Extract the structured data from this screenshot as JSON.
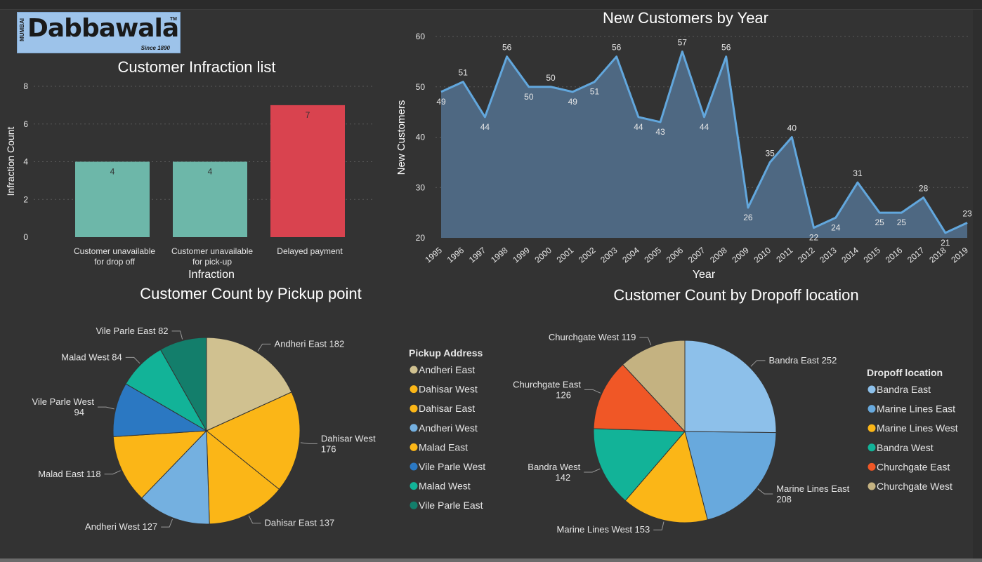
{
  "logo": {
    "word": "Dabbawala",
    "mumbai": "MUMBAI",
    "since": "Since 1890",
    "tm": "TM"
  },
  "chart_data": [
    {
      "id": "infraction",
      "type": "bar",
      "title": "Customer Infraction list",
      "xlabel": "Infraction",
      "ylabel": "Infraction Count",
      "ylim": [
        0,
        8
      ],
      "yticks": [
        0,
        2,
        4,
        6,
        8
      ],
      "grid": true,
      "categories": [
        [
          "Customer unavailable",
          "for drop off"
        ],
        [
          "Customer unavailable",
          "for pick-up"
        ],
        [
          "Delayed payment"
        ]
      ],
      "values": [
        4,
        4,
        7
      ],
      "colors": [
        "#6db7a9",
        "#6db7a9",
        "#d9434f"
      ]
    },
    {
      "id": "newcustomers",
      "type": "area",
      "title": "New Customers by Year",
      "xlabel": "Year",
      "ylabel": "New Customers",
      "ylim": [
        20,
        60
      ],
      "yticks": [
        20,
        30,
        40,
        50,
        60
      ],
      "grid": true,
      "x": [
        "1995",
        "1996",
        "1997",
        "1998",
        "1999",
        "2000",
        "2001",
        "2002",
        "2003",
        "2004",
        "2005",
        "2006",
        "2007",
        "2008",
        "2009",
        "2010",
        "2011",
        "2012",
        "2013",
        "2014",
        "2015",
        "2016",
        "2017",
        "2018",
        "2019"
      ],
      "values": [
        49,
        51,
        44,
        56,
        50,
        50,
        49,
        51,
        56,
        44,
        43,
        57,
        44,
        56,
        26,
        35,
        40,
        22,
        24,
        31,
        25,
        25,
        28,
        21,
        23
      ],
      "line_color": "#62a7dd",
      "fill_color": "#4e6882"
    },
    {
      "id": "pickup",
      "type": "pie",
      "title": "Customer Count by Pickup point",
      "legend_title": "Pickup Address",
      "legend_position": "right",
      "slices": [
        {
          "label": "Andheri East",
          "value": 182,
          "color": "#d0c190"
        },
        {
          "label": "Dahisar West",
          "value": 176,
          "color": "#fbb617"
        },
        {
          "label": "Dahisar East",
          "value": 137,
          "color": "#fbb617"
        },
        {
          "label": "Andheri West",
          "value": 127,
          "color": "#74b0e0"
        },
        {
          "label": "Malad East",
          "value": 118,
          "color": "#fbb617"
        },
        {
          "label": "Vile Parle West",
          "value": 94,
          "color": "#2b78c2"
        },
        {
          "label": "Malad West",
          "value": 84,
          "color": "#12b398"
        },
        {
          "label": "Vile Parle East",
          "value": 82,
          "color": "#137e6b"
        }
      ]
    },
    {
      "id": "dropoff",
      "type": "pie",
      "title": "Customer Count by Dropoff location",
      "legend_title": "Dropoff location",
      "legend_position": "right",
      "slices": [
        {
          "label": "Bandra East",
          "value": 252,
          "color": "#8dc0ea"
        },
        {
          "label": "Marine Lines East",
          "value": 208,
          "color": "#68a9dd"
        },
        {
          "label": "Marine Lines West",
          "value": 153,
          "color": "#fbb617"
        },
        {
          "label": "Bandra West",
          "value": 142,
          "color": "#12b398"
        },
        {
          "label": "Churchgate East",
          "value": 126,
          "color": "#f05726"
        },
        {
          "label": "Churchgate West",
          "value": 119,
          "color": "#c4b281"
        }
      ]
    }
  ]
}
